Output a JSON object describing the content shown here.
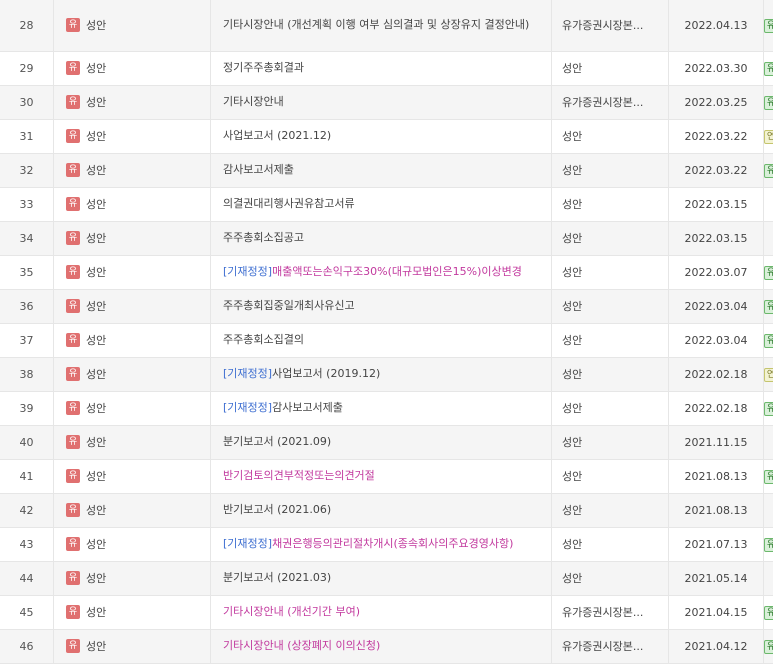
{
  "rows": [
    {
      "no": "28",
      "market": "유",
      "company": "성안",
      "corr": "",
      "title": "기타시장안내 (개선계획 이행 여부 심의결과 및 상장유지 결정안내)",
      "title_color": "normal",
      "submitter": "유가증권시장본...",
      "date": "2022.04.13",
      "flag": "유",
      "tall": true
    },
    {
      "no": "29",
      "market": "유",
      "company": "성안",
      "corr": "",
      "title": "정기주주총회결과",
      "title_color": "normal",
      "submitter": "성안",
      "date": "2022.03.30",
      "flag": "유"
    },
    {
      "no": "30",
      "market": "유",
      "company": "성안",
      "corr": "",
      "title": "기타시장안내",
      "title_color": "normal",
      "submitter": "유가증권시장본...",
      "date": "2022.03.25",
      "flag": "유"
    },
    {
      "no": "31",
      "market": "유",
      "company": "성안",
      "corr": "",
      "title": "사업보고서 (2021.12)",
      "title_color": "normal",
      "submitter": "성안",
      "date": "2022.03.22",
      "flag": "연"
    },
    {
      "no": "32",
      "market": "유",
      "company": "성안",
      "corr": "",
      "title": "감사보고서제출",
      "title_color": "normal",
      "submitter": "성안",
      "date": "2022.03.22",
      "flag": "유"
    },
    {
      "no": "33",
      "market": "유",
      "company": "성안",
      "corr": "",
      "title": "의결권대리행사권유참고서류",
      "title_color": "normal",
      "submitter": "성안",
      "date": "2022.03.15",
      "flag": ""
    },
    {
      "no": "34",
      "market": "유",
      "company": "성안",
      "corr": "",
      "title": "주주총회소집공고",
      "title_color": "normal",
      "submitter": "성안",
      "date": "2022.03.15",
      "flag": ""
    },
    {
      "no": "35",
      "market": "유",
      "company": "성안",
      "corr": "[기재정정]",
      "title": "매출액또는손익구조30%(대규모법인은15%)이상변경",
      "title_color": "pink",
      "submitter": "성안",
      "date": "2022.03.07",
      "flag": "유"
    },
    {
      "no": "36",
      "market": "유",
      "company": "성안",
      "corr": "",
      "title": "주주총회집중일개최사유신고",
      "title_color": "normal",
      "submitter": "성안",
      "date": "2022.03.04",
      "flag": "유"
    },
    {
      "no": "37",
      "market": "유",
      "company": "성안",
      "corr": "",
      "title": "주주총회소집결의",
      "title_color": "normal",
      "submitter": "성안",
      "date": "2022.03.04",
      "flag": "유"
    },
    {
      "no": "38",
      "market": "유",
      "company": "성안",
      "corr": "[기재정정]",
      "title": "사업보고서 (2019.12)",
      "title_color": "normal",
      "submitter": "성안",
      "date": "2022.02.18",
      "flag": "연"
    },
    {
      "no": "39",
      "market": "유",
      "company": "성안",
      "corr": "[기재정정]",
      "title": "감사보고서제출",
      "title_color": "normal",
      "submitter": "성안",
      "date": "2022.02.18",
      "flag": "유"
    },
    {
      "no": "40",
      "market": "유",
      "company": "성안",
      "corr": "",
      "title": "분기보고서 (2021.09)",
      "title_color": "normal",
      "submitter": "성안",
      "date": "2021.11.15",
      "flag": ""
    },
    {
      "no": "41",
      "market": "유",
      "company": "성안",
      "corr": "",
      "title": "반기검토의견부적정또는의견거절",
      "title_color": "pink",
      "submitter": "성안",
      "date": "2021.08.13",
      "flag": "유"
    },
    {
      "no": "42",
      "market": "유",
      "company": "성안",
      "corr": "",
      "title": "반기보고서 (2021.06)",
      "title_color": "normal",
      "submitter": "성안",
      "date": "2021.08.13",
      "flag": ""
    },
    {
      "no": "43",
      "market": "유",
      "company": "성안",
      "corr": "[기재정정]",
      "title": "채권은행등의관리절차개시(종속회사의주요경영사항)",
      "title_color": "pink",
      "submitter": "성안",
      "date": "2021.07.13",
      "flag": "유"
    },
    {
      "no": "44",
      "market": "유",
      "company": "성안",
      "corr": "",
      "title": "분기보고서 (2021.03)",
      "title_color": "normal",
      "submitter": "성안",
      "date": "2021.05.14",
      "flag": ""
    },
    {
      "no": "45",
      "market": "유",
      "company": "성안",
      "corr": "",
      "title": "기타시장안내 (개선기간 부여)",
      "title_color": "pink",
      "submitter": "유가증권시장본...",
      "date": "2021.04.15",
      "flag": "유"
    },
    {
      "no": "46",
      "market": "유",
      "company": "성안",
      "corr": "",
      "title": "기타시장안내 (상장폐지 이의신청)",
      "title_color": "pink",
      "submitter": "유가증권시장본...",
      "date": "2021.04.12",
      "flag": "유"
    }
  ],
  "colors": {
    "market_badge": "#e07070",
    "correction": "#3f6fd1",
    "highlight": "#c2399e",
    "row_alt": "#f5f5f5"
  }
}
